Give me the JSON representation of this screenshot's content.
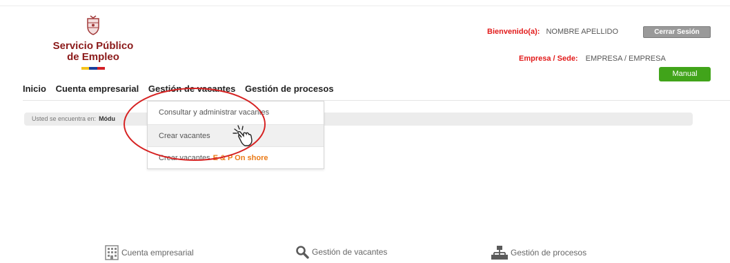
{
  "logo": {
    "line1": "Servicio Público",
    "line2": "de Empleo",
    "flag_colors": [
      "#f6c31a",
      "#1a3f9b",
      "#d31f26"
    ]
  },
  "header": {
    "welcome_label": "Bienvenido(a):",
    "user_name": "NOMBRE APELLIDO",
    "logout_label": "Cerrar Sesión",
    "company_label": "Empresa / Sede:",
    "company_value": "EMPRESA  / EMPRESA",
    "manual_label": "Manual"
  },
  "menu": {
    "items": [
      "Inicio",
      "Cuenta empresarial",
      "Gestión de vacantes",
      "Gestión de procesos"
    ]
  },
  "breadcrumb": {
    "prefix": "Usted se encuentra en:",
    "current": "Módu"
  },
  "dropdown": {
    "items": [
      {
        "label": "Consultar y administrar vacantes",
        "accent": ""
      },
      {
        "label": "Crear vacantes",
        "accent": ""
      },
      {
        "label": "Crear vacantes",
        "accent": "E & P On shore"
      }
    ]
  },
  "bottom_links": [
    {
      "label": "Cuenta empresarial",
      "icon": "building-icon"
    },
    {
      "label": "Gestión de vacantes",
      "icon": "search-icon"
    },
    {
      "label": "Gestión de procesos",
      "icon": "org-chart-icon"
    }
  ],
  "colors": {
    "brand_red": "#8b1a1a",
    "alert_red": "#e21a1a",
    "manual_green": "#41a41a",
    "accent_orange": "#ea7a16",
    "annotation_red": "#d62222"
  }
}
